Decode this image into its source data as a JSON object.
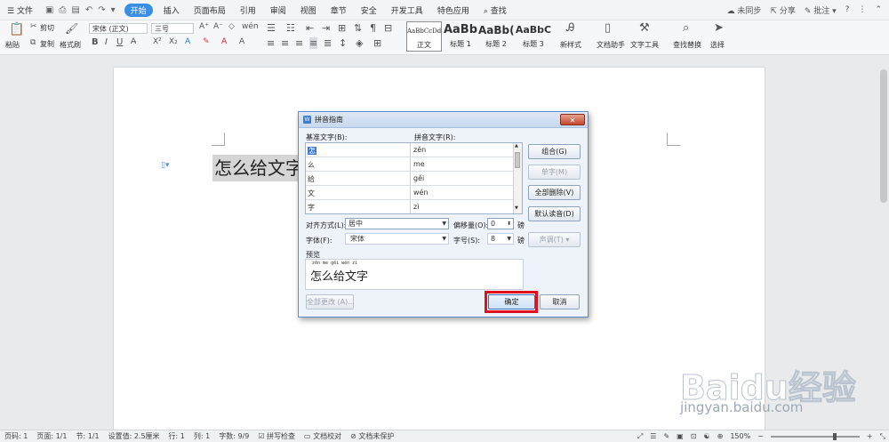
{
  "menubar": {
    "file": "文件",
    "tabs": [
      "开始",
      "插入",
      "页面布局",
      "引用",
      "审阅",
      "视图",
      "章节",
      "安全",
      "开发工具",
      "特色应用"
    ],
    "active_tab": "开始",
    "search": "查找",
    "sync": "未同步",
    "share": "分享",
    "comment": "批注"
  },
  "ribbon": {
    "paste": "粘贴",
    "cut": "剪切",
    "copy": "复制",
    "format_painter": "格式刷",
    "font_name": "宋体 (正文)",
    "font_size": "三号",
    "styles": [
      {
        "sample": "AaBbCcDd",
        "name": "正文"
      },
      {
        "sample": "AaBb",
        "name": "标题 1"
      },
      {
        "sample": "AaBb(",
        "name": "标题 2"
      },
      {
        "sample": "AaBbC",
        "name": "标题 3"
      }
    ],
    "new_style": "新样式",
    "doc_helper": "文档助手",
    "text_tools": "文字工具",
    "find_replace": "查找替换",
    "select": "选择"
  },
  "document": {
    "text": "怎么给文字"
  },
  "dialog": {
    "title": "拼音指南",
    "close": "✕",
    "base_text_label": "基准文字(B):",
    "pinyin_label": "拼音文字(R):",
    "rows": [
      {
        "base": "怎",
        "pinyin": "zěn"
      },
      {
        "base": "么",
        "pinyin": "me"
      },
      {
        "base": "给",
        "pinyin": "gěi"
      },
      {
        "base": "文",
        "pinyin": "wén"
      },
      {
        "base": "字",
        "pinyin": "zì"
      }
    ],
    "buttons": {
      "combine": "组合(G)",
      "single": "单字(M)",
      "delete_all": "全部删除(V)",
      "default_reading": "默认读音(D)",
      "tone": "声调(T)",
      "change_all": "全部更改 (A)...",
      "ok": "确定",
      "cancel": "取消"
    },
    "align_label": "对齐方式(L):",
    "align_value": "居中",
    "offset_label": "偏移量(O):",
    "offset_value": "0",
    "offset_unit": "磅",
    "font_label": "字体(F):",
    "font_value": "宋体",
    "size_label": "字号(S):",
    "size_value": "8",
    "size_unit": "磅",
    "preview_label": "预览",
    "preview_pinyin": "zěn me gěi wén zì",
    "preview_text": "怎么给文字"
  },
  "statusbar": {
    "page_num": "页码: 1",
    "pages": "页面: 1/1",
    "section": "节: 1/1",
    "setting": "设置值: 2.5厘米",
    "row": "行: 1",
    "col": "列: 1",
    "words": "字数: 9/9",
    "spell": "拼写检查",
    "proof": "文档校对",
    "protect": "文档未保护",
    "zoom": "150%"
  },
  "watermark": {
    "brand": "Baidu经验",
    "url": "jingyan.baidu.com"
  }
}
